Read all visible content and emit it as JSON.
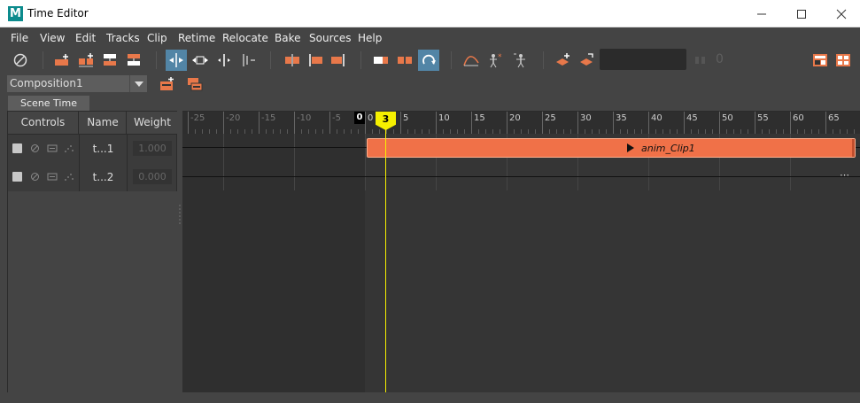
{
  "window": {
    "title": "Time Editor",
    "logo_letter": "M"
  },
  "menu": [
    "File",
    "View",
    "Edit",
    "Tracks",
    "Clip",
    "Retime",
    "Relocate",
    "Bake",
    "Sources",
    "Help"
  ],
  "composition": {
    "selected": "Composition1"
  },
  "tabs": {
    "scene_time": "Scene Time"
  },
  "columns": {
    "controls": "Controls",
    "name": "Name",
    "weight": "Weight"
  },
  "tracks": [
    {
      "name": "t...1",
      "weight": "1.000"
    },
    {
      "name": "t...2",
      "weight": "0.000"
    }
  ],
  "ruler": {
    "labels": [
      "-25",
      "-20",
      "-15",
      "-10",
      "-5",
      "0",
      "0",
      "5",
      "10",
      "15",
      "20",
      "25",
      "30",
      "35",
      "40",
      "45",
      "50",
      "55",
      "60",
      "65"
    ],
    "current_time": "3"
  },
  "clip": {
    "name": "anim_Clip1"
  },
  "toolbar": {
    "value_field": "",
    "offset_label": "0"
  }
}
